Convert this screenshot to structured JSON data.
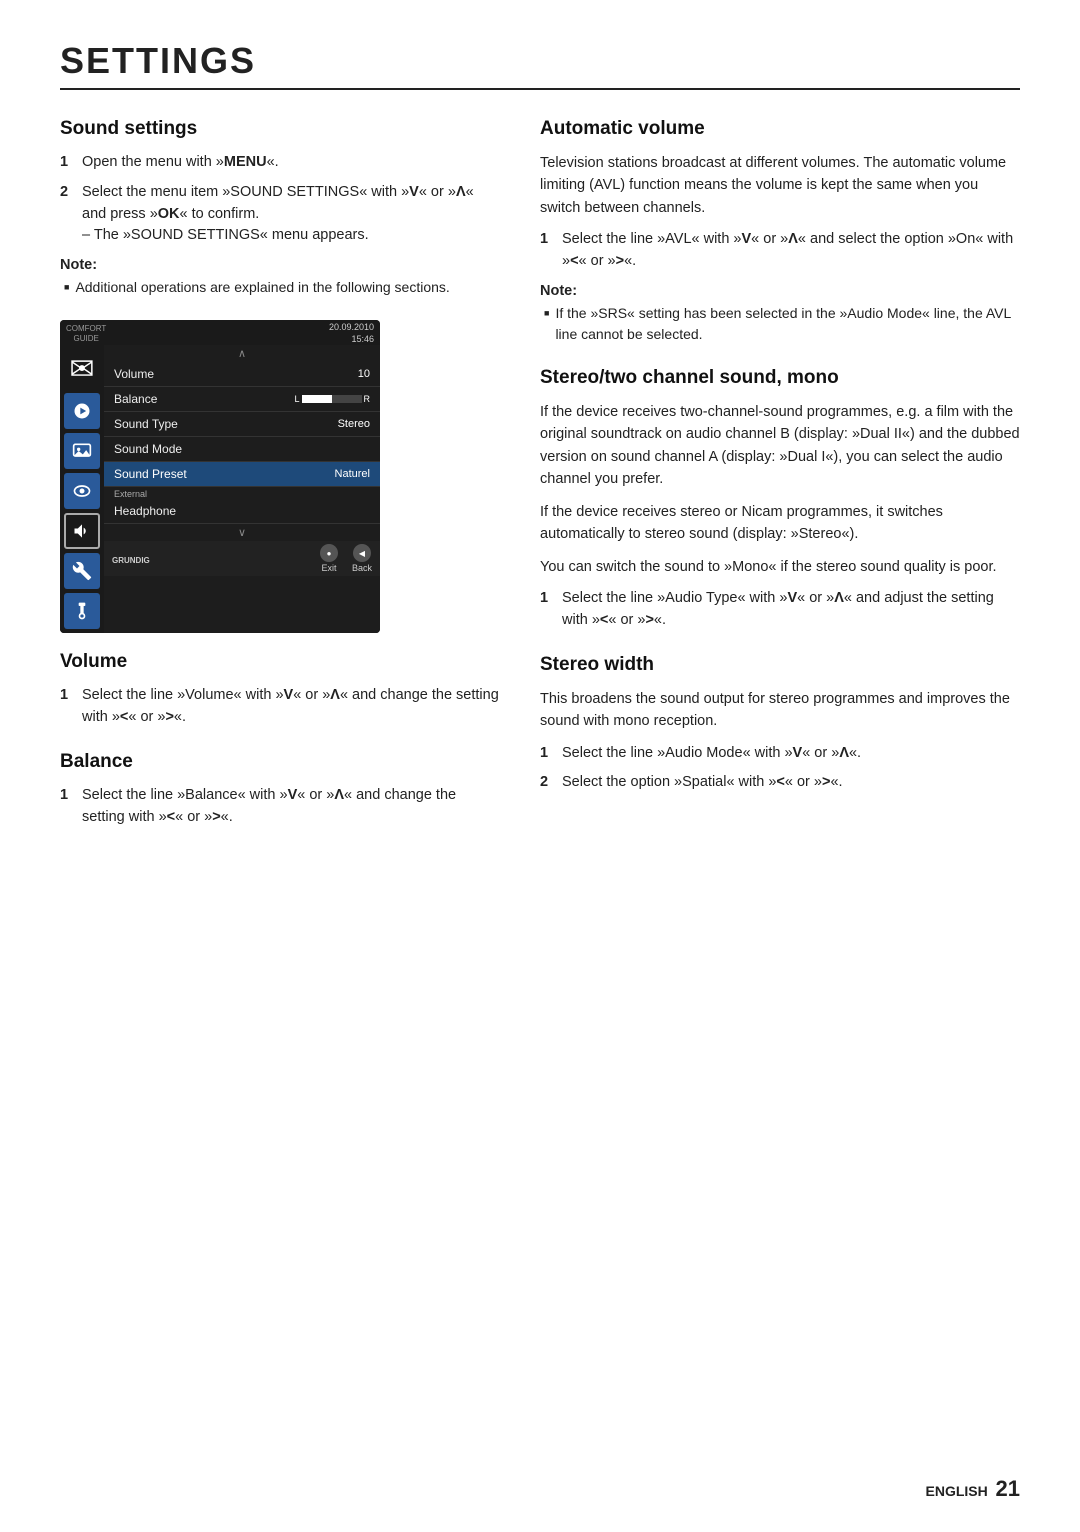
{
  "page": {
    "title": "SETTINGS",
    "footer_lang": "ENGLISH",
    "footer_page": "21"
  },
  "left_column": {
    "sound_settings": {
      "heading": "Sound settings",
      "steps": [
        {
          "num": "1",
          "text": "Open the menu with »MENU«."
        },
        {
          "num": "2",
          "text": "Select the menu item »SOUND SETTINGS« with »V« or »Λ« and press »OK« to confirm.\n– The »SOUND SETTINGS« menu appears."
        }
      ],
      "note_title": "Note:",
      "note_items": [
        "Additional operations are explained in the following sections."
      ]
    },
    "tv_screen": {
      "time_line1": "20.09.2010",
      "time_line2": "15:46",
      "sidebar_top_label": "COMFORT\nGUIDE",
      "menu_rows": [
        {
          "label": "Volume",
          "value": "10",
          "type": "normal"
        },
        {
          "label": "Balance",
          "value": "bar",
          "type": "balance"
        },
        {
          "label": "Sound Type",
          "value": "Stereo",
          "type": "normal"
        },
        {
          "label": "Sound Mode",
          "value": "",
          "type": "normal"
        },
        {
          "label": "Sound Preset",
          "value": "Naturel",
          "type": "selected"
        },
        {
          "label": "Headphone",
          "value": "",
          "type": "normal"
        }
      ],
      "external_label": "External",
      "btn1": "Exit",
      "btn2": "Back",
      "logo": "GRUNDIG"
    },
    "volume": {
      "heading": "Volume",
      "steps": [
        {
          "num": "1",
          "text": "Select the line »Volume« with »V« or »Λ« and change the setting with »<« or »>«."
        }
      ]
    },
    "balance": {
      "heading": "Balance",
      "steps": [
        {
          "num": "1",
          "text": "Select the line »Balance« with »V« or »Λ« and change the setting with »<« or »>«."
        }
      ]
    }
  },
  "right_column": {
    "automatic_volume": {
      "heading": "Automatic volume",
      "body1": "Television stations broadcast at different volumes. The automatic volume limiting (AVL) function means the volume is kept the same when you switch between channels.",
      "steps": [
        {
          "num": "1",
          "text": "Select the line »AVL« with »V« or »Λ« and select the option »On« with »<« or »>«."
        }
      ],
      "note_title": "Note:",
      "note_items": [
        "If the »SRS« setting has been selected in the »Audio Mode« line, the AVL line cannot be selected."
      ]
    },
    "stereo_mono": {
      "heading": "Stereo/two channel sound, mono",
      "body1": "If the device receives two-channel-sound programmes, e.g. a film with the original soundtrack on audio channel B (display: »Dual II«) and the dubbed version on sound channel A (display: »Dual I«), you can select the audio channel you prefer.",
      "body2": "If the device receives stereo or Nicam programmes, it switches automatically to stereo sound (display: »Stereo«).",
      "body3": "You can switch the sound to »Mono« if the stereo sound quality is poor.",
      "steps": [
        {
          "num": "1",
          "text": "Select the line »Audio Type« with »V« or »Λ« and adjust the setting with »<« or »>«."
        }
      ]
    },
    "stereo_width": {
      "heading": "Stereo width",
      "body1": "This broadens the sound output for stereo programmes and improves the sound with mono reception.",
      "steps": [
        {
          "num": "1",
          "text": "Select the line »Audio Mode« with »V« or »Λ«."
        },
        {
          "num": "2",
          "text": "Select the option »Spatial« with »<« or »>«."
        }
      ]
    }
  }
}
